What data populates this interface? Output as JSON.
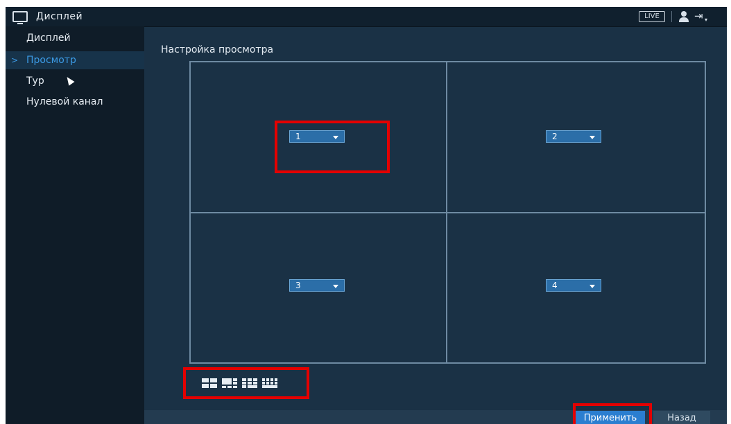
{
  "topbar": {
    "title": "Дисплей",
    "live_label": "LIVE",
    "icons": [
      "monitor-icon",
      "user-icon",
      "logout-icon"
    ]
  },
  "sidebar": {
    "items": [
      {
        "label": "Дисплей",
        "active": false
      },
      {
        "label": "Просмотр",
        "active": true
      },
      {
        "label": "Тур",
        "active": false
      },
      {
        "label": "Нулевой канал",
        "active": false
      }
    ],
    "active_chevron": ">"
  },
  "main": {
    "title": "Настройка просмотра",
    "cells": [
      {
        "channel": "1"
      },
      {
        "channel": "2"
      },
      {
        "channel": "3"
      },
      {
        "channel": "4"
      }
    ],
    "layout_options": [
      "1x4",
      "1x6",
      "1x8",
      "1x9"
    ]
  },
  "buttons": {
    "apply_label": "Применить",
    "back_label": "Назад"
  },
  "colors": {
    "background": "#1a3145",
    "sidebar": "#0f1c28",
    "accent": "#2b7ed0",
    "highlight_red": "#e40000"
  }
}
